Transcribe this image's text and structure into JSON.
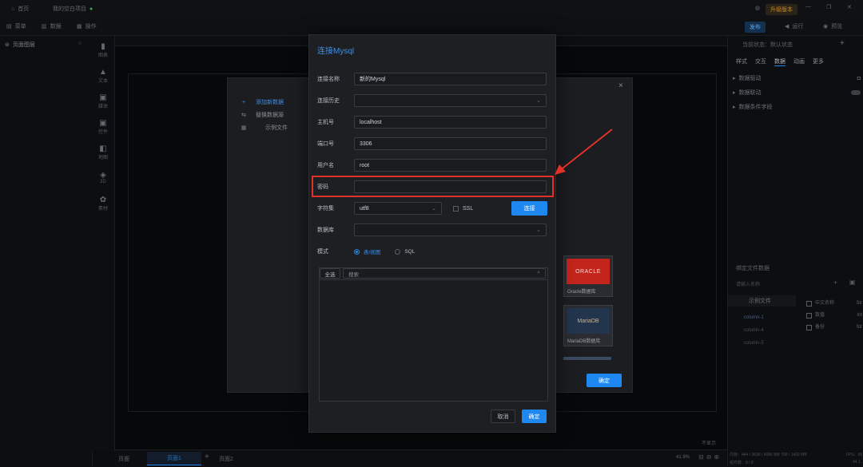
{
  "titlebar": {
    "home": "首页",
    "project": "我的空白项目",
    "badge": "升级版本"
  },
  "menubar": {
    "menus": [
      "菜单",
      "数据",
      "操作"
    ],
    "preview": "预览",
    "publish": "发布",
    "run": "运行"
  },
  "left_panel": {
    "title": "页面图层"
  },
  "icon_column": [
    "图表",
    "文本",
    "媒体",
    "控件",
    "地图",
    "3D",
    "素材"
  ],
  "right_panel": {
    "state": "当前状态：默认状态",
    "tabs": [
      "样式",
      "交互",
      "数据",
      "动画",
      "更多"
    ],
    "items": [
      "数据驱动",
      "数据联动",
      "数据条件字段"
    ],
    "section2": "绑定文件数据",
    "search": "请输入名称",
    "tree_header": "示例文件",
    "tree": [
      "column-1",
      "column-4",
      "column-5"
    ],
    "fields": [
      "中文名称",
      "数值",
      "备份"
    ],
    "field_types": [
      "Str",
      "Int",
      "Str"
    ],
    "status_mem": "内存：444 / 3636 / 4096 MB   768 / 1432 MB",
    "status_fps": "FPS：60",
    "status_count": "组件数：8 / 8",
    "zoom": "44.1"
  },
  "bottombar": {
    "page1": "页面",
    "page2": "页面1",
    "add": "+",
    "page3": "页面2",
    "zoom": "41.9%",
    "hint": "不显示"
  },
  "bg_dialog": {
    "nav": [
      {
        "mark": "+",
        "label": "添加新数据"
      },
      {
        "mark": "⇆",
        "label": "替换数据源"
      },
      {
        "mark": "▦",
        "label": "示例文件"
      }
    ],
    "cards": [
      "Oracle数据库",
      "MariaDB数据库"
    ],
    "oracle_logo": "ORACLE",
    "maria_logo": "MariaDB",
    "confirm": "确定",
    "close": "×"
  },
  "dialog": {
    "title": "连接Mysql",
    "fields": {
      "name_label": "连接名称",
      "name_value": "新的Mysql",
      "history_label": "连接历史",
      "host_label": "主机号",
      "host_value": "localhost",
      "port_label": "端口号",
      "port_value": "3306",
      "user_label": "用户名",
      "user_value": "root",
      "password_label": "密码",
      "password_value": "",
      "charset_label": "字符集",
      "charset_value": "utf8",
      "ssl_label": "SSL",
      "connect": "连接",
      "db_label": "数据库",
      "mode_label": "模式",
      "mode_table": "表/视图",
      "mode_sql": "SQL"
    },
    "table": {
      "select_all": "全选",
      "search_placeholder": "搜索"
    },
    "cancel": "取消",
    "ok": "确定"
  },
  "colors": {
    "accent": "#1f88f0",
    "highlight": "#e0312b",
    "dialog_bg": "#1e1f23"
  }
}
